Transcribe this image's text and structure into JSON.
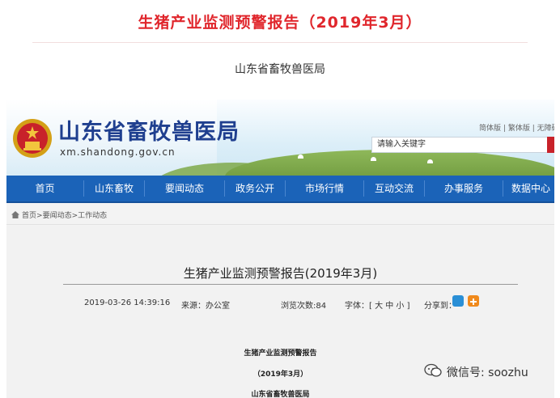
{
  "header": {
    "title": "生猪产业监测预警报告（2019年3月）",
    "subtitle": "山东省畜牧兽医局"
  },
  "site": {
    "name": "山东省畜牧兽医局",
    "url": "xm.shandong.gov.cn",
    "lang_links": [
      "简体版",
      "繁体版",
      "无障碍浏"
    ],
    "search_placeholder": "请输入关键字"
  },
  "nav": {
    "items": [
      "首页",
      "山东畜牧",
      "要闻动态",
      "政务公开",
      "市场行情",
      "互动交流",
      "办事服务",
      "数据中心"
    ]
  },
  "breadcrumb": {
    "items": [
      "首页",
      "要闻动态",
      "工作动态"
    ]
  },
  "article": {
    "title": "生猪产业监测预警报告(2019年3月)",
    "date": "2019-03-26 14:39:16",
    "source": "来源：办公室",
    "views": "浏览次数:84",
    "font_size": "字体：[ 大 中 小 ]",
    "share_label": "分享到：",
    "body_title": "生猪产业监测预警报告",
    "body_date": "（2019年3月）",
    "body_org": "山东省畜牧兽医局"
  },
  "watermark": {
    "text": "微信号: soozhu"
  },
  "colors": {
    "title_red": "#e0262c",
    "nav_blue": "#1b63b8",
    "site_name_blue": "#1f3f8f"
  }
}
